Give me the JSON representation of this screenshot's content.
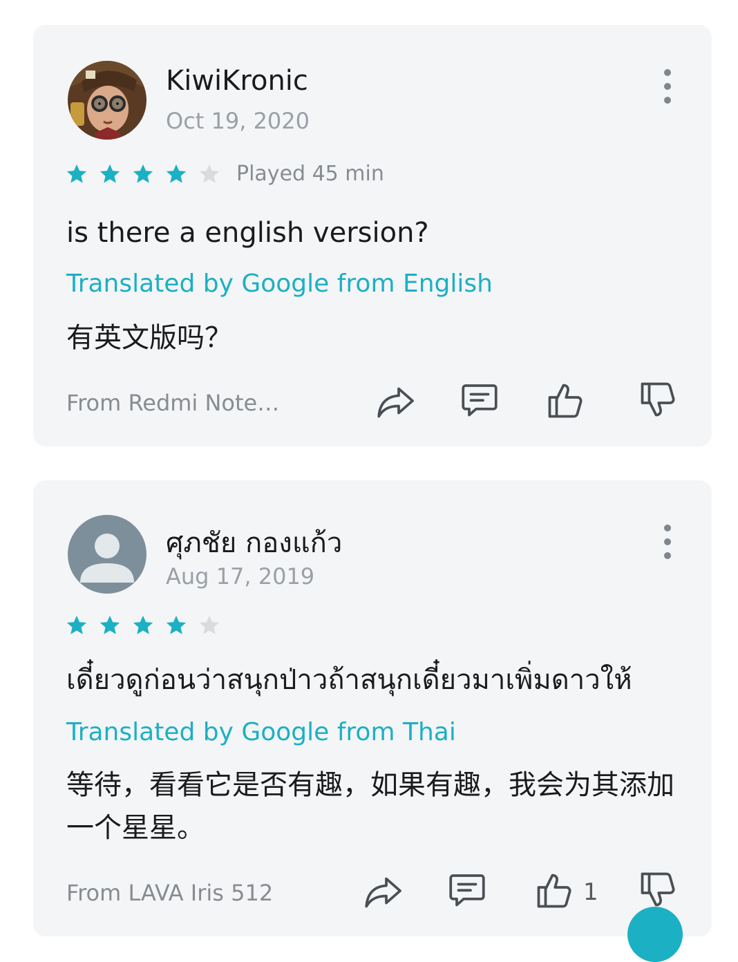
{
  "reviews": [
    {
      "name": "KiwiKronic",
      "date": "Oct 19, 2020",
      "rating": 4,
      "played": "Played 45 min",
      "text": "is there a english version?",
      "translated_label": "Translated by Google from English",
      "translation": "有英文版吗？",
      "device": "From Redmi Note…",
      "likes": ""
    },
    {
      "name": "ศุภชัย กองแก้ว",
      "date": "Aug 17, 2019",
      "rating": 4,
      "played": "",
      "text": "เดี๋ยวดูก่อนว่าสนุกป่าวถ้าสนุกเดี๋ยวมาเพิ่มดาวให้",
      "translated_label": "Translated by Google from Thai",
      "translation": "等待，看看它是否有趣，如果有趣，我会为其添加一个星星。",
      "device": "From LAVA Iris 512",
      "likes": "1"
    }
  ],
  "icons": {
    "share": "share-icon",
    "reply": "comment-icon",
    "like": "thumbs-up-icon",
    "dislike": "thumbs-down-icon",
    "more": "more-vertical-icon"
  },
  "colors": {
    "accent": "#1bb0c4",
    "star_filled": "#1bb0c4",
    "star_empty": "#d9dbde",
    "card_bg": "#f4f5f7"
  }
}
